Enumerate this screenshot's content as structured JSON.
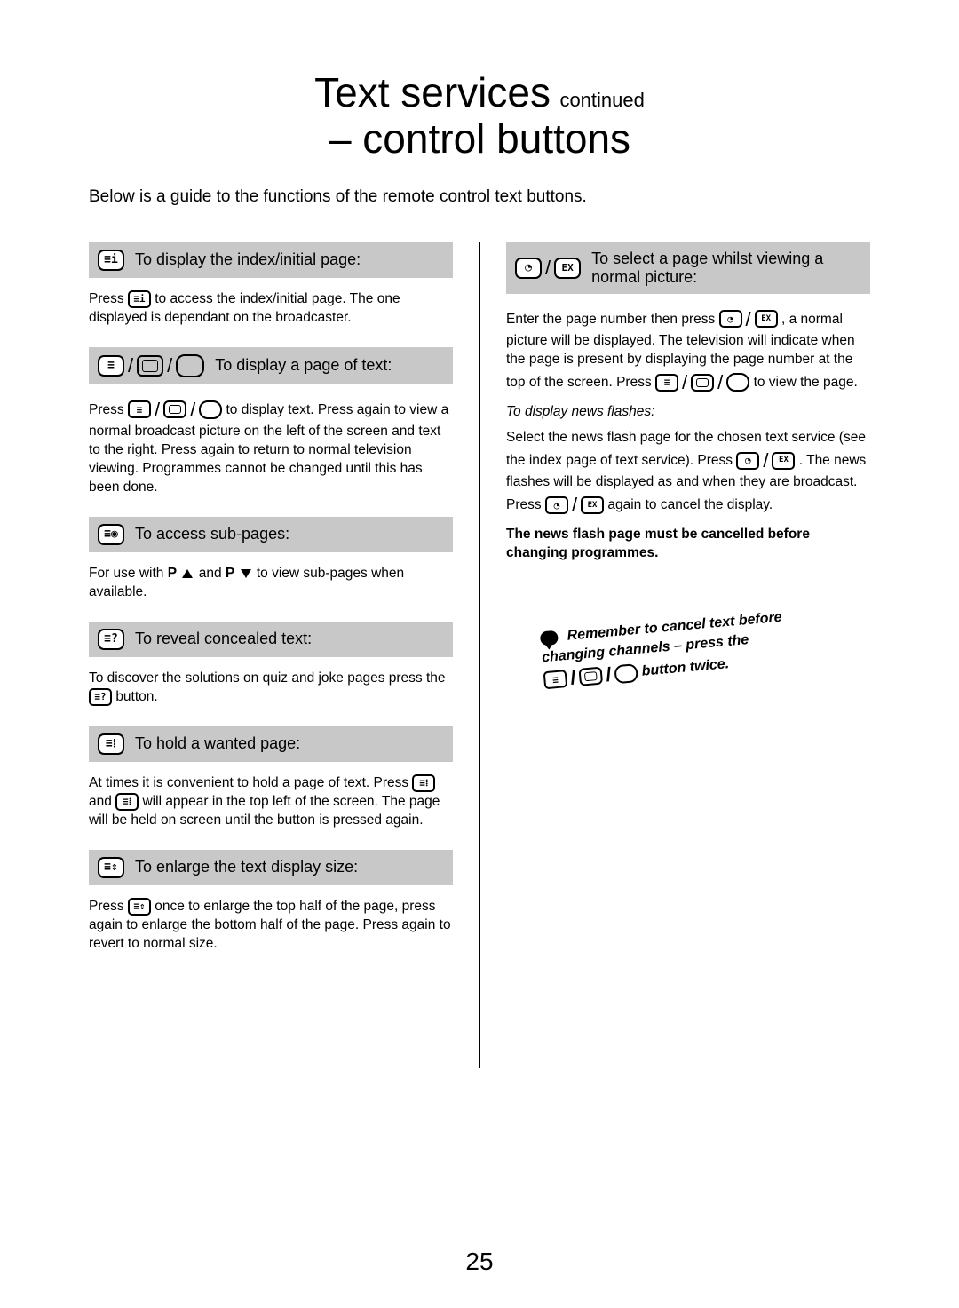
{
  "header": {
    "title": "Text services",
    "continued": "continued",
    "subtitle": "– control buttons"
  },
  "intro": "Below is a guide to the functions of the remote control text buttons.",
  "left": {
    "s1": {
      "heading": "To display the index/initial page:",
      "body_a": "Press ",
      "body_b": " to access the index/initial page. The one displayed is dependant on the broadcaster."
    },
    "s2": {
      "heading": "To display a page of text:",
      "body_a": "Press ",
      "body_b": " to display text. Press again to view a normal broadcast picture on the left of the screen and text to the right. Press again to return to normal television viewing. Programmes cannot be changed until this has been done."
    },
    "s3": {
      "heading": "To access sub-pages:",
      "body_a": "For use with ",
      "p_label": "P",
      "body_mid": " and  ",
      "body_b": " to view sub-pages when available."
    },
    "s4": {
      "heading": "To reveal concealed text:",
      "body_a": "To discover the solutions on quiz and joke pages press the ",
      "body_b": " button."
    },
    "s5": {
      "heading": "To hold a wanted page:",
      "body_a": "At times it is convenient to hold a page of text. Press ",
      "body_mid": " and ",
      "body_b": " will appear in the top left of the screen. The page will be held on screen until the button is pressed again."
    },
    "s6": {
      "heading": "To enlarge the text display size:",
      "body_a": "Press ",
      "body_b": " once to enlarge the top half of the page, press again to enlarge the bottom half of the page. Press again to revert to normal size."
    }
  },
  "right": {
    "s1": {
      "heading": "To select a page whilst viewing a normal picture:",
      "body_a": "Enter the page number then press ",
      "body_b": ", a normal picture will be displayed. The television will indicate when the page is present by displaying the page number at the top of the screen. Press ",
      "body_c": " to view the page."
    },
    "news_heading": "To display news flashes:",
    "news_a": "Select the news flash page for the chosen text service (see the index page of text service). Press ",
    "news_b": ". The news flashes will be displayed as and when they are broadcast. Press ",
    "news_c": " again to cancel the display.",
    "warning": "The news flash page must be cancelled before changing programmes.",
    "remember_a": "Remember to cancel text before changing channels – press the ",
    "remember_b": " button twice."
  },
  "icon_labels": {
    "index": "≡i",
    "text": "≡",
    "sub": "≡◉",
    "reveal": "≡?",
    "hold": "≡⁞",
    "enlarge": "≡⇕",
    "clock": "◔",
    "ex": "EX"
  },
  "page_number": "25"
}
